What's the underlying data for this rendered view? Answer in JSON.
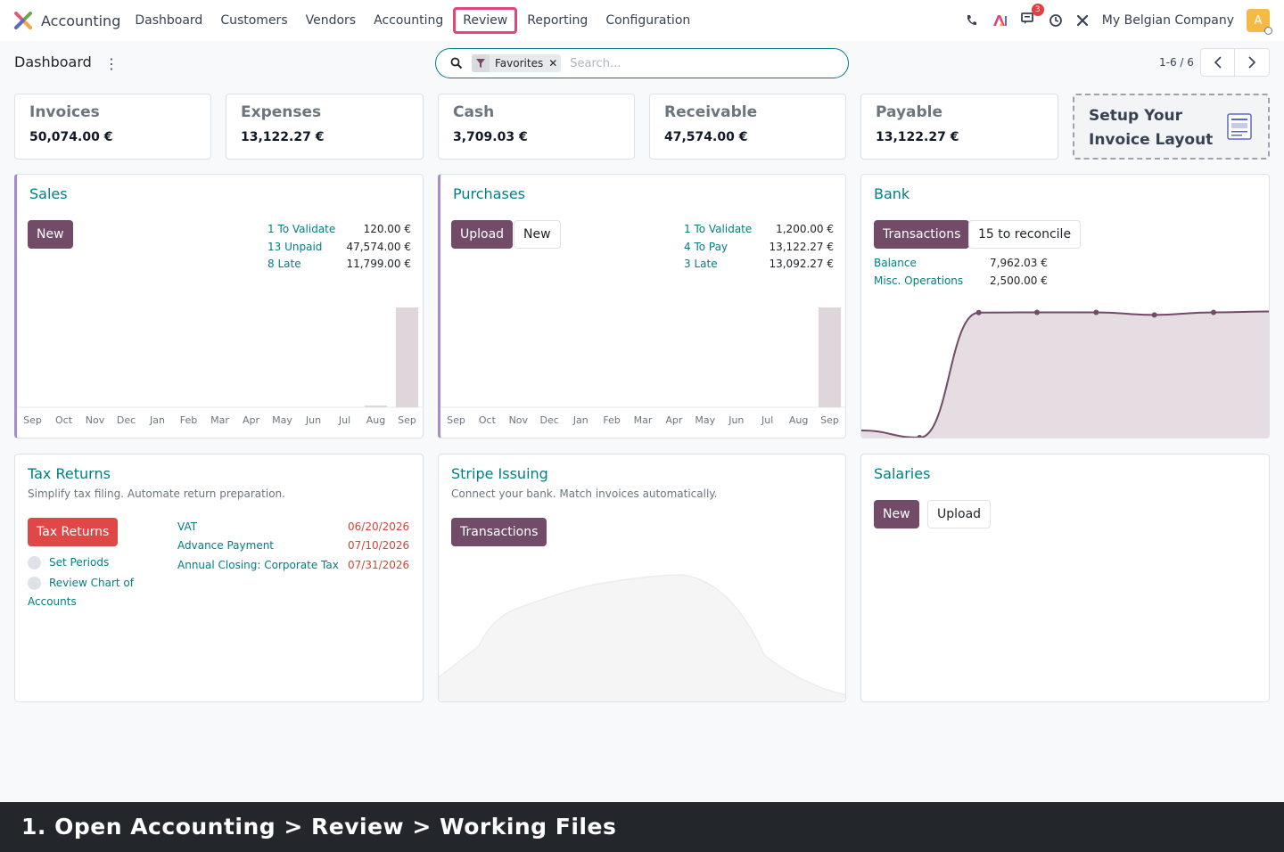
{
  "app": {
    "name": "Accounting"
  },
  "nav": {
    "menu": [
      {
        "label": "Dashboard",
        "active": false
      },
      {
        "label": "Customers",
        "active": false
      },
      {
        "label": "Vendors",
        "active": false
      },
      {
        "label": "Accounting",
        "active": false
      },
      {
        "label": "Review",
        "active": true
      },
      {
        "label": "Reporting",
        "active": false
      },
      {
        "label": "Configuration",
        "active": false
      }
    ],
    "messages_badge": "3",
    "company": "My Belgian Company",
    "avatar_initial": "A",
    "icons": [
      "phone-icon",
      "ai-icon",
      "chat-icon",
      "clock-icon",
      "tools-icon"
    ]
  },
  "control": {
    "title": "Dashboard",
    "search": {
      "facet": "Favorites",
      "placeholder": "Search..."
    },
    "pager": "1-6 / 6"
  },
  "kpis": [
    {
      "title": "Invoices",
      "value": "50,074.00 €"
    },
    {
      "title": "Expenses",
      "value": "13,122.27 €"
    },
    {
      "title": "Cash",
      "value": "3,709.03 €"
    },
    {
      "title": "Receivable",
      "value": "47,574.00 €"
    },
    {
      "title": "Payable",
      "value": "13,122.27 €"
    }
  ],
  "setup": {
    "line1": "Setup Your",
    "line2": "Invoice Layout"
  },
  "months": [
    "Sep",
    "Oct",
    "Nov",
    "Dec",
    "Jan",
    "Feb",
    "Mar",
    "Apr",
    "May",
    "Jun",
    "Jul",
    "Aug",
    "Sep"
  ],
  "sales": {
    "title": "Sales",
    "new_label": "New",
    "stats": [
      {
        "label": "1 To Validate",
        "value": "120.00 €"
      },
      {
        "label": "13 Unpaid",
        "value": "47,574.00 €"
      },
      {
        "label": "8 Late",
        "value": "11,799.00 €"
      }
    ]
  },
  "purchases": {
    "title": "Purchases",
    "upload_label": "Upload",
    "new_label": "New",
    "stats": [
      {
        "label": "1 To Validate",
        "value": "1,200.00 €"
      },
      {
        "label": "4 To Pay",
        "value": "13,122.27 €"
      },
      {
        "label": "3 Late",
        "value": "13,092.27 €"
      }
    ]
  },
  "bank": {
    "title": "Bank",
    "transactions_label": "Transactions",
    "reconcile_label": "15 to reconcile",
    "stats": [
      {
        "label": "Balance",
        "value": "7,962.03 €"
      },
      {
        "label": "Misc. Operations",
        "value": "2,500.00 €"
      }
    ]
  },
  "tax": {
    "title": "Tax Returns",
    "subtitle": "Simplify tax filing. Automate return preparation.",
    "button_label": "Tax Returns",
    "checklist": [
      "Set Periods",
      "Review Chart of",
      "Accounts"
    ],
    "deadlines": [
      {
        "label": "VAT",
        "date": "06/20/2026"
      },
      {
        "label": "Advance Payment",
        "date": "07/10/2026"
      },
      {
        "label": "Annual Closing: Corporate Tax",
        "date": "07/31/2026"
      }
    ]
  },
  "stripe": {
    "title": "Stripe Issuing",
    "subtitle": "Connect your bank. Match invoices automatically.",
    "button_label": "Transactions"
  },
  "salaries": {
    "title": "Salaries",
    "new_label": "New",
    "upload_label": "Upload"
  },
  "footer": {
    "caption": "1. Open Accounting > Review > Working Files"
  },
  "colors": {
    "primary": "#714b67",
    "accent": "#017e84",
    "danger": "#e04848",
    "highlight": "#e0457b"
  },
  "chart_data": [
    {
      "type": "bar",
      "categories": [
        "Sep",
        "Oct",
        "Nov",
        "Dec",
        "Jan",
        "Feb",
        "Mar",
        "Apr",
        "May",
        "Jun",
        "Jul",
        "Aug",
        "Sep"
      ],
      "values": [
        0,
        0,
        0,
        0,
        0,
        0,
        0,
        0,
        0,
        0,
        0,
        1,
        50074
      ]
    },
    {
      "type": "bar",
      "categories": [
        "Sep",
        "Oct",
        "Nov",
        "Dec",
        "Jan",
        "Feb",
        "Mar",
        "Apr",
        "May",
        "Jun",
        "Jul",
        "Aug",
        "Sep"
      ],
      "values": [
        0,
        0,
        0,
        0,
        0,
        0,
        0,
        0,
        0,
        0,
        0,
        0,
        13122
      ]
    },
    {
      "type": "area",
      "values": [
        450,
        0,
        7950,
        7962,
        7962,
        7800,
        7962
      ]
    }
  ]
}
